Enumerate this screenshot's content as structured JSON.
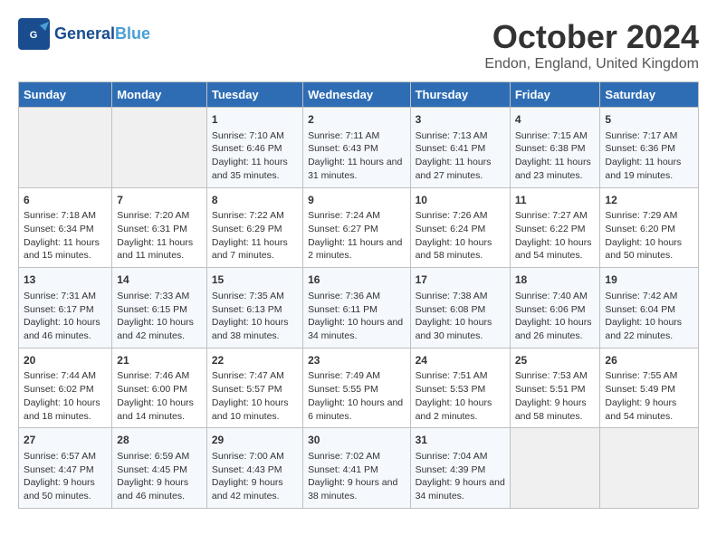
{
  "logo": {
    "line1": "General",
    "line2": "Blue"
  },
  "title": {
    "month": "October 2024",
    "location": "Endon, England, United Kingdom"
  },
  "weekdays": [
    "Sunday",
    "Monday",
    "Tuesday",
    "Wednesday",
    "Thursday",
    "Friday",
    "Saturday"
  ],
  "weeks": [
    [
      {
        "day": "",
        "sunrise": "",
        "sunset": "",
        "daylight": ""
      },
      {
        "day": "",
        "sunrise": "",
        "sunset": "",
        "daylight": ""
      },
      {
        "day": "1",
        "sunrise": "Sunrise: 7:10 AM",
        "sunset": "Sunset: 6:46 PM",
        "daylight": "Daylight: 11 hours and 35 minutes."
      },
      {
        "day": "2",
        "sunrise": "Sunrise: 7:11 AM",
        "sunset": "Sunset: 6:43 PM",
        "daylight": "Daylight: 11 hours and 31 minutes."
      },
      {
        "day": "3",
        "sunrise": "Sunrise: 7:13 AM",
        "sunset": "Sunset: 6:41 PM",
        "daylight": "Daylight: 11 hours and 27 minutes."
      },
      {
        "day": "4",
        "sunrise": "Sunrise: 7:15 AM",
        "sunset": "Sunset: 6:38 PM",
        "daylight": "Daylight: 11 hours and 23 minutes."
      },
      {
        "day": "5",
        "sunrise": "Sunrise: 7:17 AM",
        "sunset": "Sunset: 6:36 PM",
        "daylight": "Daylight: 11 hours and 19 minutes."
      }
    ],
    [
      {
        "day": "6",
        "sunrise": "Sunrise: 7:18 AM",
        "sunset": "Sunset: 6:34 PM",
        "daylight": "Daylight: 11 hours and 15 minutes."
      },
      {
        "day": "7",
        "sunrise": "Sunrise: 7:20 AM",
        "sunset": "Sunset: 6:31 PM",
        "daylight": "Daylight: 11 hours and 11 minutes."
      },
      {
        "day": "8",
        "sunrise": "Sunrise: 7:22 AM",
        "sunset": "Sunset: 6:29 PM",
        "daylight": "Daylight: 11 hours and 7 minutes."
      },
      {
        "day": "9",
        "sunrise": "Sunrise: 7:24 AM",
        "sunset": "Sunset: 6:27 PM",
        "daylight": "Daylight: 11 hours and 2 minutes."
      },
      {
        "day": "10",
        "sunrise": "Sunrise: 7:26 AM",
        "sunset": "Sunset: 6:24 PM",
        "daylight": "Daylight: 10 hours and 58 minutes."
      },
      {
        "day": "11",
        "sunrise": "Sunrise: 7:27 AM",
        "sunset": "Sunset: 6:22 PM",
        "daylight": "Daylight: 10 hours and 54 minutes."
      },
      {
        "day": "12",
        "sunrise": "Sunrise: 7:29 AM",
        "sunset": "Sunset: 6:20 PM",
        "daylight": "Daylight: 10 hours and 50 minutes."
      }
    ],
    [
      {
        "day": "13",
        "sunrise": "Sunrise: 7:31 AM",
        "sunset": "Sunset: 6:17 PM",
        "daylight": "Daylight: 10 hours and 46 minutes."
      },
      {
        "day": "14",
        "sunrise": "Sunrise: 7:33 AM",
        "sunset": "Sunset: 6:15 PM",
        "daylight": "Daylight: 10 hours and 42 minutes."
      },
      {
        "day": "15",
        "sunrise": "Sunrise: 7:35 AM",
        "sunset": "Sunset: 6:13 PM",
        "daylight": "Daylight: 10 hours and 38 minutes."
      },
      {
        "day": "16",
        "sunrise": "Sunrise: 7:36 AM",
        "sunset": "Sunset: 6:11 PM",
        "daylight": "Daylight: 10 hours and 34 minutes."
      },
      {
        "day": "17",
        "sunrise": "Sunrise: 7:38 AM",
        "sunset": "Sunset: 6:08 PM",
        "daylight": "Daylight: 10 hours and 30 minutes."
      },
      {
        "day": "18",
        "sunrise": "Sunrise: 7:40 AM",
        "sunset": "Sunset: 6:06 PM",
        "daylight": "Daylight: 10 hours and 26 minutes."
      },
      {
        "day": "19",
        "sunrise": "Sunrise: 7:42 AM",
        "sunset": "Sunset: 6:04 PM",
        "daylight": "Daylight: 10 hours and 22 minutes."
      }
    ],
    [
      {
        "day": "20",
        "sunrise": "Sunrise: 7:44 AM",
        "sunset": "Sunset: 6:02 PM",
        "daylight": "Daylight: 10 hours and 18 minutes."
      },
      {
        "day": "21",
        "sunrise": "Sunrise: 7:46 AM",
        "sunset": "Sunset: 6:00 PM",
        "daylight": "Daylight: 10 hours and 14 minutes."
      },
      {
        "day": "22",
        "sunrise": "Sunrise: 7:47 AM",
        "sunset": "Sunset: 5:57 PM",
        "daylight": "Daylight: 10 hours and 10 minutes."
      },
      {
        "day": "23",
        "sunrise": "Sunrise: 7:49 AM",
        "sunset": "Sunset: 5:55 PM",
        "daylight": "Daylight: 10 hours and 6 minutes."
      },
      {
        "day": "24",
        "sunrise": "Sunrise: 7:51 AM",
        "sunset": "Sunset: 5:53 PM",
        "daylight": "Daylight: 10 hours and 2 minutes."
      },
      {
        "day": "25",
        "sunrise": "Sunrise: 7:53 AM",
        "sunset": "Sunset: 5:51 PM",
        "daylight": "Daylight: 9 hours and 58 minutes."
      },
      {
        "day": "26",
        "sunrise": "Sunrise: 7:55 AM",
        "sunset": "Sunset: 5:49 PM",
        "daylight": "Daylight: 9 hours and 54 minutes."
      }
    ],
    [
      {
        "day": "27",
        "sunrise": "Sunrise: 6:57 AM",
        "sunset": "Sunset: 4:47 PM",
        "daylight": "Daylight: 9 hours and 50 minutes."
      },
      {
        "day": "28",
        "sunrise": "Sunrise: 6:59 AM",
        "sunset": "Sunset: 4:45 PM",
        "daylight": "Daylight: 9 hours and 46 minutes."
      },
      {
        "day": "29",
        "sunrise": "Sunrise: 7:00 AM",
        "sunset": "Sunset: 4:43 PM",
        "daylight": "Daylight: 9 hours and 42 minutes."
      },
      {
        "day": "30",
        "sunrise": "Sunrise: 7:02 AM",
        "sunset": "Sunset: 4:41 PM",
        "daylight": "Daylight: 9 hours and 38 minutes."
      },
      {
        "day": "31",
        "sunrise": "Sunrise: 7:04 AM",
        "sunset": "Sunset: 4:39 PM",
        "daylight": "Daylight: 9 hours and 34 minutes."
      },
      {
        "day": "",
        "sunrise": "",
        "sunset": "",
        "daylight": ""
      },
      {
        "day": "",
        "sunrise": "",
        "sunset": "",
        "daylight": ""
      }
    ]
  ]
}
